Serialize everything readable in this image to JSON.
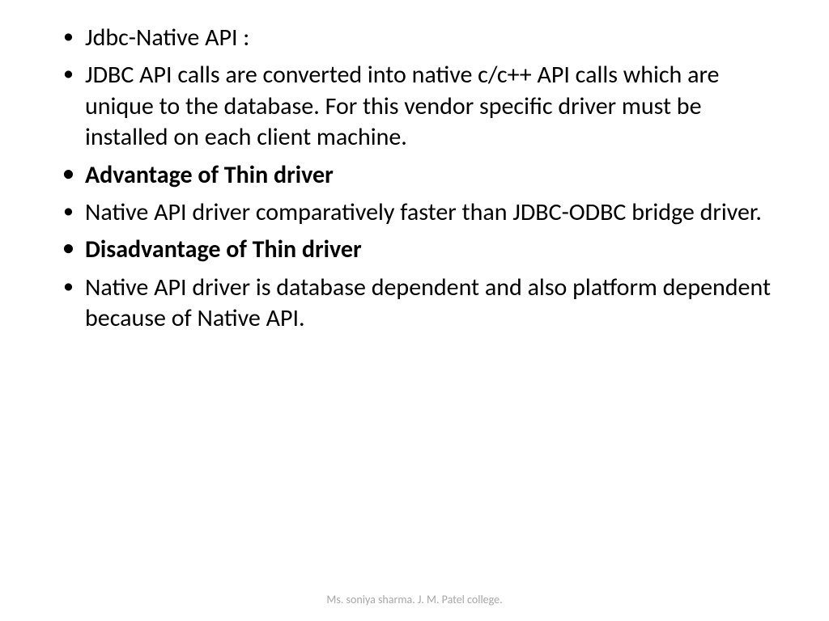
{
  "slide": {
    "bullets": [
      {
        "text": "Jdbc-Native API :",
        "bold": false
      },
      {
        "text": "JDBC API calls are converted into native c/c++ API calls which are unique to the database. For this vendor specific driver must be installed on each client machine.",
        "bold": false
      },
      {
        "text": "Advantage of Thin driver",
        "bold": true
      },
      {
        "text": "Native API driver comparatively faster than JDBC-ODBC bridge driver.",
        "bold": false
      },
      {
        "text": "Disadvantage of Thin driver",
        "bold": true
      },
      {
        "text": "Native API driver is database dependent and also platform dependent because of Native API.",
        "bold": false
      }
    ],
    "footer": "Ms. soniya sharma. J. M. Patel college."
  }
}
